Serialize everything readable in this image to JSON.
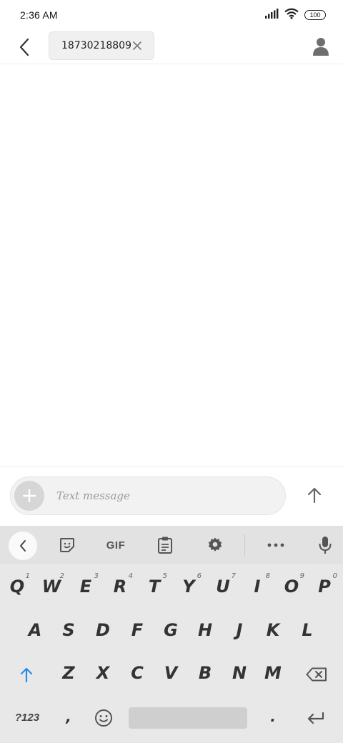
{
  "status": {
    "time": "2:36 AM",
    "battery": "100"
  },
  "header": {
    "recipient": "18730218809"
  },
  "compose": {
    "placeholder": "Text message"
  },
  "keyboard": {
    "toolbar": {
      "gif_label": "GIF"
    },
    "row1": [
      {
        "label": "Q",
        "hint": "1"
      },
      {
        "label": "W",
        "hint": "2"
      },
      {
        "label": "E",
        "hint": "3"
      },
      {
        "label": "R",
        "hint": "4"
      },
      {
        "label": "T",
        "hint": "5"
      },
      {
        "label": "Y",
        "hint": "6"
      },
      {
        "label": "U",
        "hint": "7"
      },
      {
        "label": "I",
        "hint": "8"
      },
      {
        "label": "O",
        "hint": "9"
      },
      {
        "label": "P",
        "hint": "0"
      }
    ],
    "row2": [
      "A",
      "S",
      "D",
      "F",
      "G",
      "H",
      "J",
      "K",
      "L"
    ],
    "row3": [
      "Z",
      "X",
      "C",
      "V",
      "B",
      "N",
      "M"
    ],
    "row4": {
      "symbols_label": "?123",
      "comma": ",",
      "period": "."
    }
  }
}
